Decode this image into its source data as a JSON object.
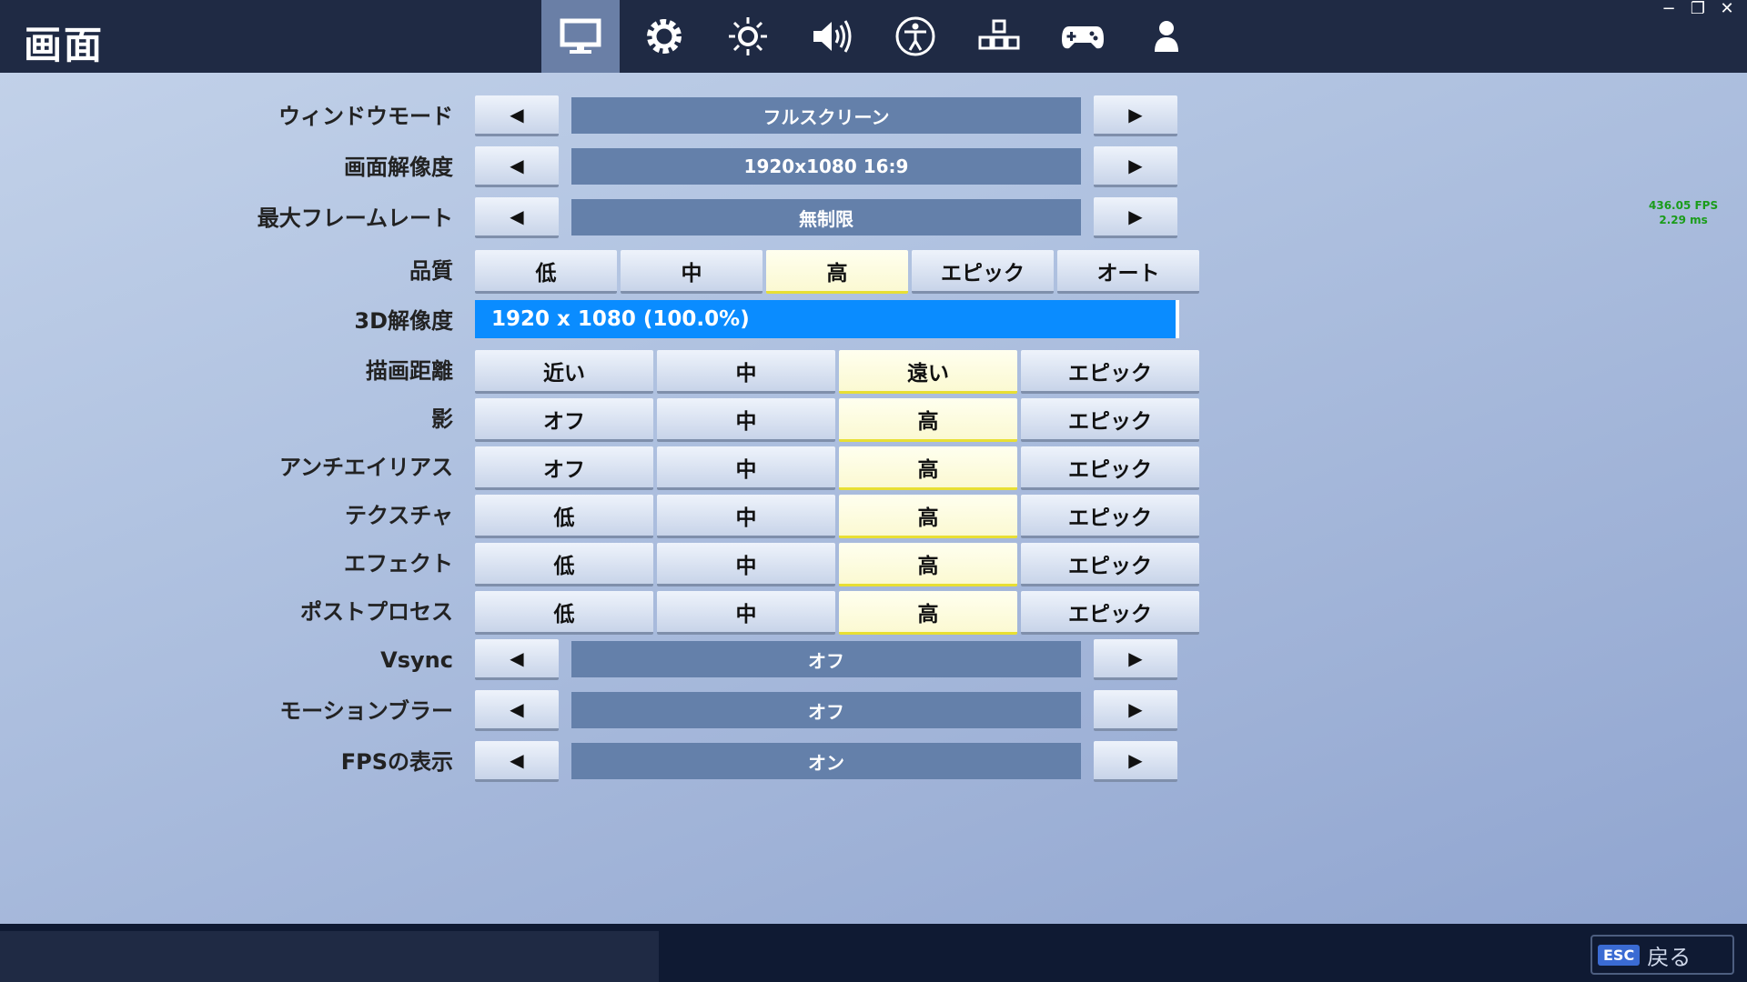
{
  "header": {
    "title": "画面",
    "tabs": [
      {
        "icon": "monitor-icon",
        "active": true
      },
      {
        "icon": "gear-icon",
        "active": false
      },
      {
        "icon": "brightness-icon",
        "active": false
      },
      {
        "icon": "speaker-icon",
        "active": false
      },
      {
        "icon": "accessibility-icon",
        "active": false
      },
      {
        "icon": "input-keys-icon",
        "active": false
      },
      {
        "icon": "gamepad-icon",
        "active": false
      },
      {
        "icon": "account-icon",
        "active": false
      }
    ],
    "window_controls": {
      "minimize": "−",
      "restore": "❐",
      "close": "✕"
    }
  },
  "settings": {
    "window_mode": {
      "label": "ウィンドウモード",
      "value": "フルスクリーン"
    },
    "resolution": {
      "label": "画面解像度",
      "value": "1920x1080 16:9"
    },
    "frame_rate": {
      "label": "最大フレームレート",
      "value": "無制限"
    },
    "quality": {
      "label": "品質",
      "options": [
        "低",
        "中",
        "高",
        "エピック",
        "オート"
      ],
      "selected": 2
    },
    "res3d": {
      "label": "3D解像度",
      "value": "1920 x 1080 (100.0%)",
      "percent": 100
    },
    "view_distance": {
      "label": "描画距離",
      "options": [
        "近い",
        "中",
        "遠い",
        "エピック"
      ],
      "selected": 2
    },
    "shadows": {
      "label": "影",
      "options": [
        "オフ",
        "中",
        "高",
        "エピック"
      ],
      "selected": 2
    },
    "anti_aliasing": {
      "label": "アンチエイリアス",
      "options": [
        "オフ",
        "中",
        "高",
        "エピック"
      ],
      "selected": 2
    },
    "textures": {
      "label": "テクスチャ",
      "options": [
        "低",
        "中",
        "高",
        "エピック"
      ],
      "selected": 2
    },
    "effects": {
      "label": "エフェクト",
      "options": [
        "低",
        "中",
        "高",
        "エピック"
      ],
      "selected": 2
    },
    "post_process": {
      "label": "ポストプロセス",
      "options": [
        "低",
        "中",
        "高",
        "エピック"
      ],
      "selected": 2
    },
    "vsync": {
      "label": "Vsync",
      "value": "オフ"
    },
    "motion_blur": {
      "label": "モーションブラー",
      "value": "オフ"
    },
    "show_fps": {
      "label": "FPSの表示",
      "value": "オン"
    },
    "arrow_left": "◀",
    "arrow_right": "▶"
  },
  "fps_counter": {
    "fps": "436.05 FPS",
    "ms": "2.29 ms"
  },
  "footer": {
    "esc_key": "ESC",
    "back_label": "戻る"
  }
}
